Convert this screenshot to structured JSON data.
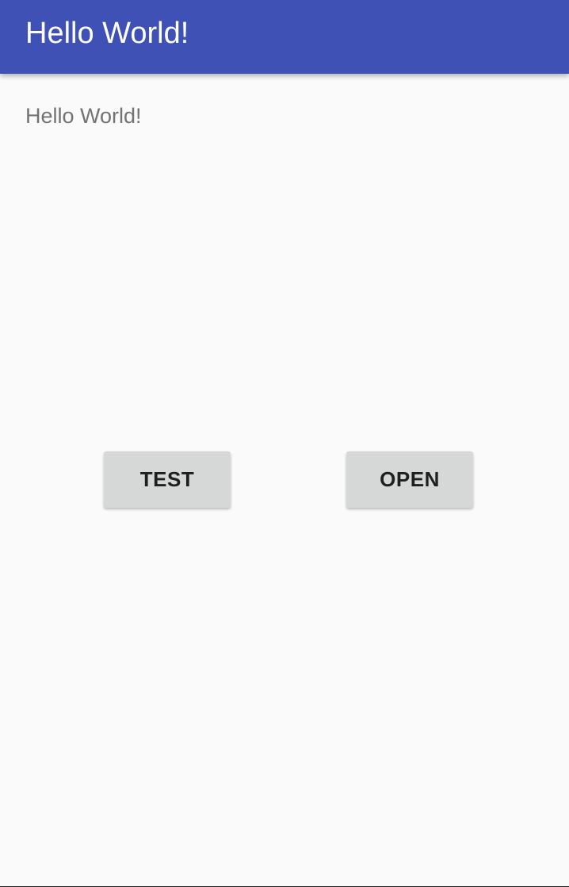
{
  "app_bar": {
    "title": "Hello World!",
    "color": "#3f51b5"
  },
  "content": {
    "hello_text": "Hello World!"
  },
  "buttons": {
    "test_label": "TEST",
    "open_label": "OPEN"
  }
}
